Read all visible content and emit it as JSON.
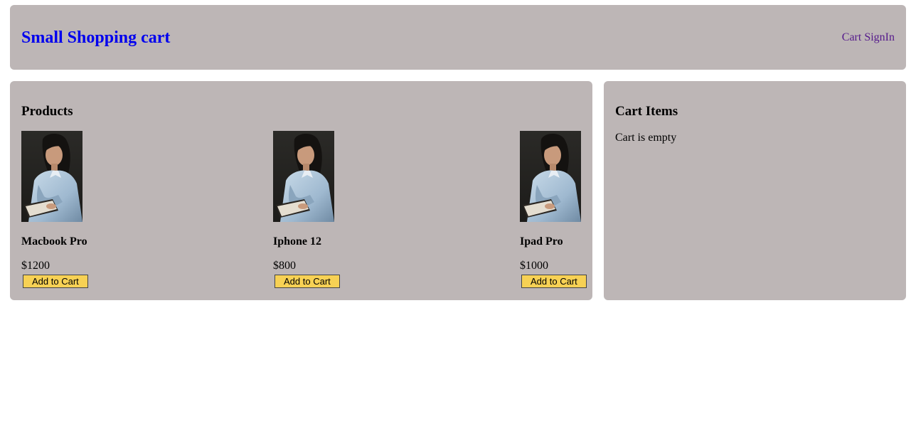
{
  "header": {
    "brand": "Small Shopping cart",
    "nav": [
      {
        "label": "Cart"
      },
      {
        "label": "SignIn"
      }
    ]
  },
  "products": {
    "title": "Products",
    "items": [
      {
        "name": "Macbook Pro",
        "price": "$1200",
        "button": "Add to Cart",
        "image_alt": "product-image"
      },
      {
        "name": "Iphone 12",
        "price": "$800",
        "button": "Add to Cart",
        "image_alt": "product-image"
      },
      {
        "name": "Ipad Pro",
        "price": "$1000",
        "button": "Add to Cart",
        "image_alt": "product-image"
      }
    ]
  },
  "cart": {
    "title": "Cart Items",
    "empty_text": "Cart is empty"
  },
  "colors": {
    "panel_bg": "#bdb6b6",
    "brand": "#0000ee",
    "nav_link": "#551a8b",
    "button_bg": "#f7d154"
  }
}
